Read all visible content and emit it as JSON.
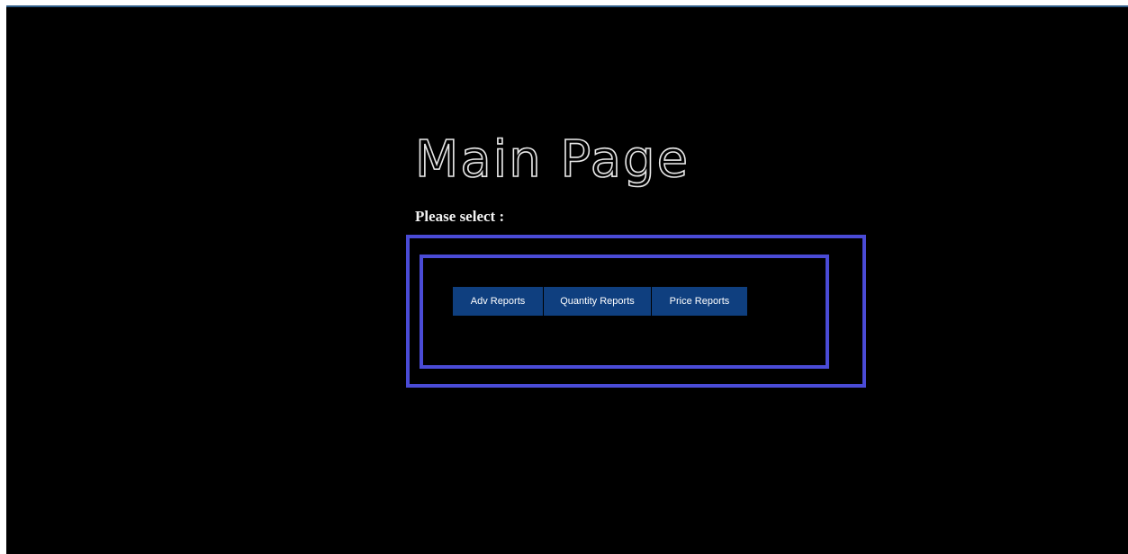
{
  "page": {
    "title": "Main Page",
    "prompt": "Please select :"
  },
  "buttons": {
    "adv_reports": "Adv Reports",
    "quantity_reports": "Quantity Reports",
    "price_reports": "Price Reports"
  },
  "colors": {
    "background": "#000000",
    "frame": "#4a4bd6",
    "button": "#0f3f7f",
    "text": "#f2f2f2"
  }
}
